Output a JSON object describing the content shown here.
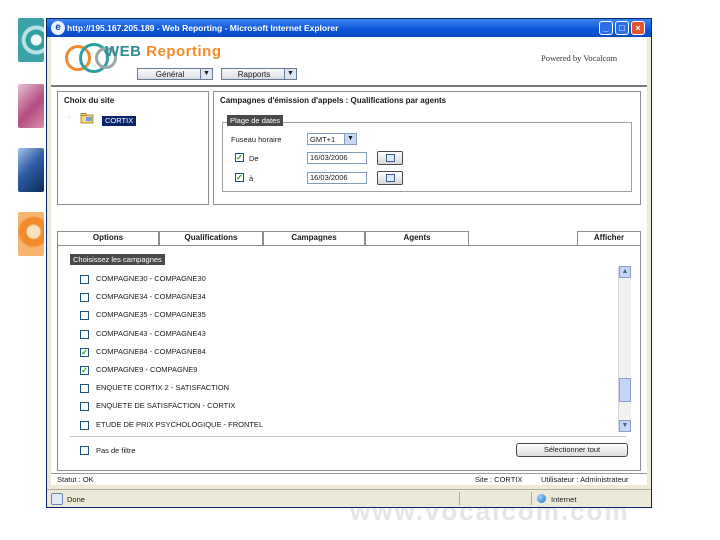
{
  "window": {
    "title": "http://195.167.205.189 - Web Reporting - Microsoft Internet Explorer"
  },
  "logo": {
    "web": "WEB",
    "reporting": " Reporting"
  },
  "header": {
    "powered_by": "Powered by Vocalcom"
  },
  "menu": [
    {
      "label": "Général"
    },
    {
      "label": "Rapports"
    }
  ],
  "site_panel": {
    "title": "Choix du site",
    "node": "CORTIX"
  },
  "campaign_panel": {
    "title": "Campagnes d'émission d'appels : Qualifications par agents",
    "range_legend": "Plage de dates",
    "timezone_label": "Fuseau horaire",
    "timezone_value": "GMT+1",
    "from_label": "De",
    "from_value": "16/03/2006",
    "to_label": "à",
    "to_value": "16/03/2006"
  },
  "tabs": [
    {
      "label": "Options"
    },
    {
      "label": "Qualifications"
    },
    {
      "label": "Campagnes"
    },
    {
      "label": "Agents"
    }
  ],
  "display_tab": "Afficher",
  "campaign_list": {
    "legend": "Choisissez les campagnes",
    "items": [
      {
        "label": "COMPAGNE30 - COMPAGNE30",
        "checked": false
      },
      {
        "label": "COMPAGNE34 - COMPAGNE34",
        "checked": false
      },
      {
        "label": "COMPAGNE35 - COMPAGNE35",
        "checked": false
      },
      {
        "label": "COMPAGNE43 - COMPAGNE43",
        "checked": false
      },
      {
        "label": "COMPAGNE84 - COMPAGNE84",
        "checked": true
      },
      {
        "label": "COMPAGNE9 - COMPAGNE9",
        "checked": true
      },
      {
        "label": "ENQUETE CORTIX 2 - SATISFACTION",
        "checked": false
      },
      {
        "label": "ENQUETE DE SATISFACTION - CORTIX",
        "checked": false
      },
      {
        "label": "ETUDE DE PRIX PSYCHOLOGIQUE - FRONTEL",
        "checked": false
      }
    ],
    "no_filter_label": "Pas de filtre",
    "select_all_label": "Sélectionner tout"
  },
  "app_status": {
    "status": "Statut : OK",
    "site": "Site : CORTIX",
    "user": "Utilisateur : Administrateur"
  },
  "browser_status": {
    "done": "Done",
    "zone": "Internet"
  },
  "watermark": "www.vocalcom.com",
  "colors": {
    "title_bar": "#0b55d8",
    "logo_orange": "#f28c2a",
    "logo_teal": "#2e8f95",
    "selected": "#0a246a"
  }
}
